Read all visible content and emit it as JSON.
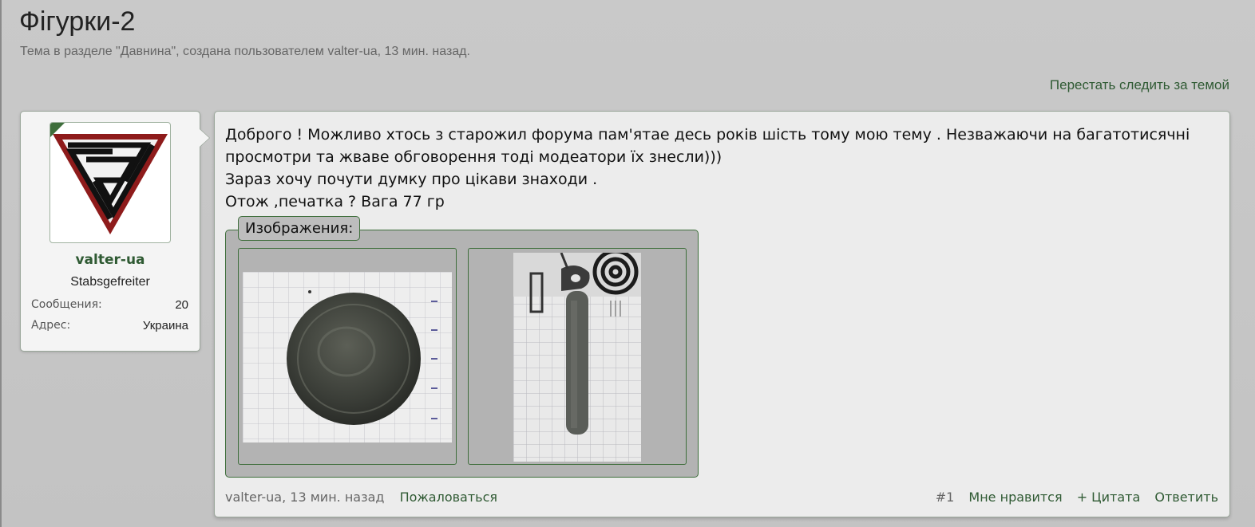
{
  "thread": {
    "title": "Фігурки-2",
    "description": "Тема в разделе \"Давнина\", создана пользователем valter-ua, 13 мин. назад.",
    "unwatch_label": "Перестать следить за темой"
  },
  "user": {
    "name": "valter-ua",
    "title": "Stabsgefreiter",
    "stats": [
      {
        "label": "Сообщения:",
        "value": "20"
      },
      {
        "label": "Адрес:",
        "value": "Украина"
      }
    ],
    "avatar_icon": "triskelion-emblem-icon"
  },
  "post": {
    "lines": [
      "Доброго ! Можливо хтось з старожил форума пам'ятае десь років шість тому мою тему . Незважаючи на багатотисячні",
      "просмотри та жваве обговорення тоді модеатори їх знесли)))",
      "Зараз хочу почути думку про цікави знаходи .",
      "Отож ,печатка ? Вага 77 гр"
    ],
    "attachments_label": "Изображения:",
    "attachments": [
      {
        "icon": "round-seal-photo"
      },
      {
        "icon": "seal-side-photo"
      }
    ],
    "footer": {
      "author_date": "valter-ua, 13 мин. назад",
      "report": "Пожаловаться",
      "number": "#1",
      "like": "Мне нравится",
      "quote": "+ Цитата",
      "reply": "Ответить"
    }
  },
  "colors": {
    "accent": "#2f5a33",
    "background": "#c6c6c6",
    "panel": "#ececec"
  }
}
